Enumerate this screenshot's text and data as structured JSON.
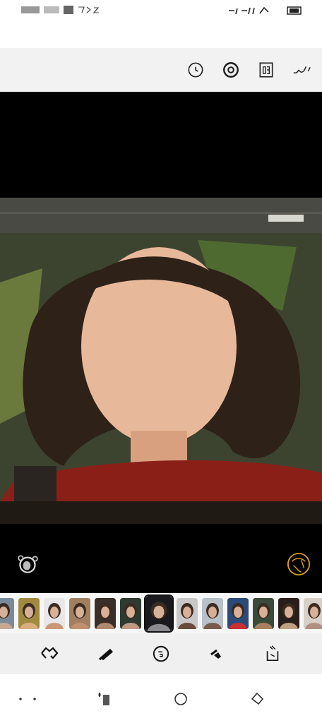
{
  "thumbnails": [
    {
      "selected": false
    },
    {
      "selected": false
    },
    {
      "selected": false
    },
    {
      "selected": false
    },
    {
      "selected": false
    },
    {
      "selected": false
    },
    {
      "selected": true
    },
    {
      "selected": false
    },
    {
      "selected": false
    },
    {
      "selected": false
    },
    {
      "selected": false
    },
    {
      "selected": false
    },
    {
      "selected": false
    }
  ]
}
